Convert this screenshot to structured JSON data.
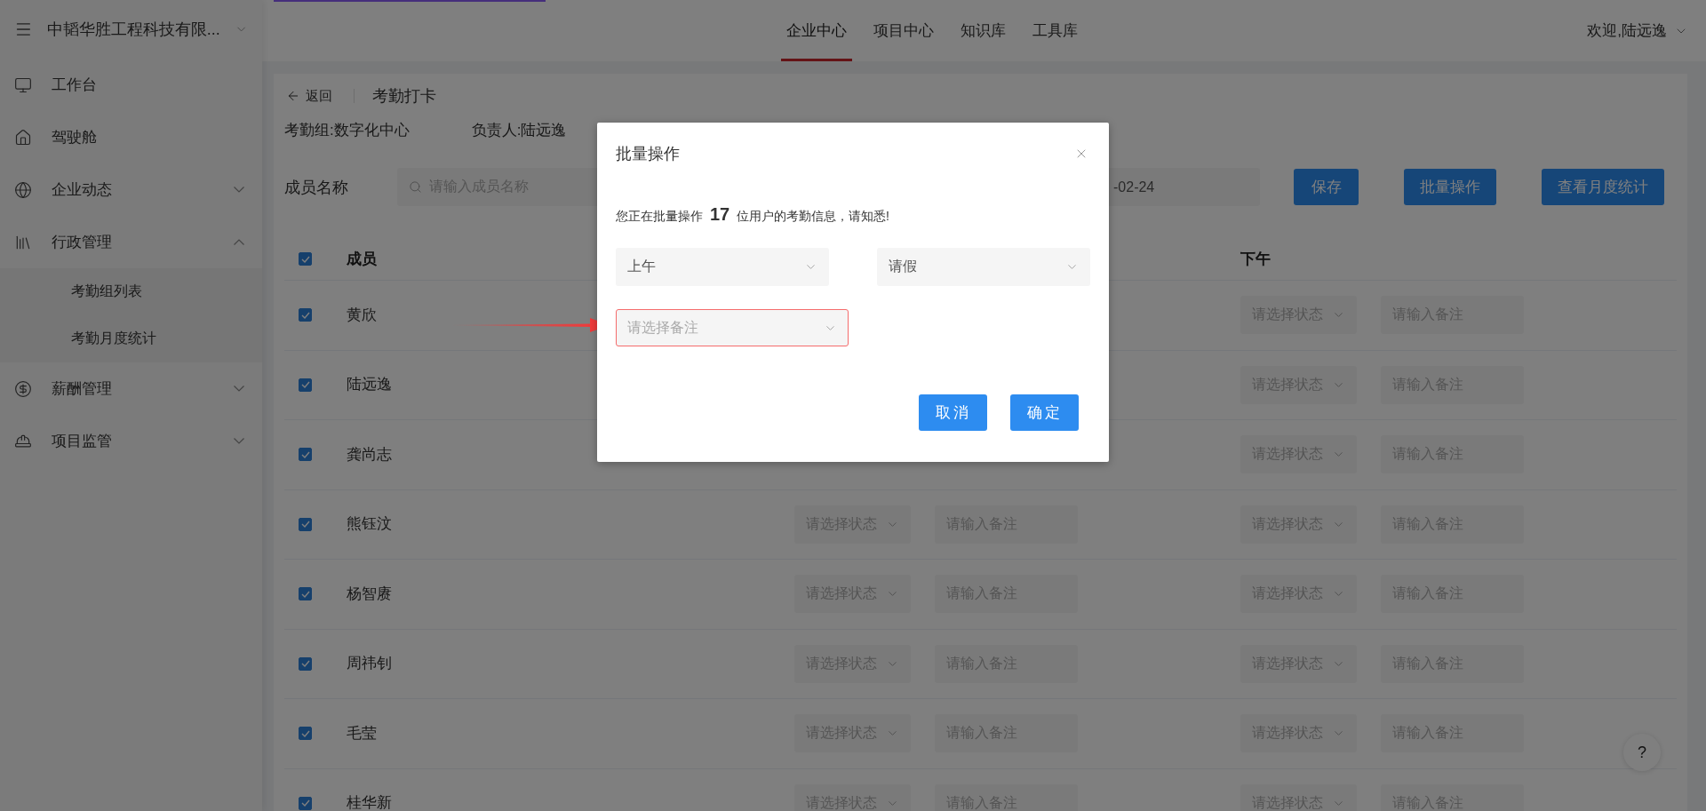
{
  "header": {
    "company": "中韬华胜工程科技有限...",
    "nav": [
      {
        "label": "企业中心",
        "selected": true
      },
      {
        "label": "项目中心",
        "selected": false
      },
      {
        "label": "知识库",
        "selected": false
      },
      {
        "label": "工具库",
        "selected": false
      }
    ],
    "user": "欢迎,陆远逸"
  },
  "sidebar": {
    "items": [
      {
        "label": "工作台"
      },
      {
        "label": "驾驶舱"
      },
      {
        "label": "企业动态",
        "expanded": false
      },
      {
        "label": "行政管理",
        "expanded": true,
        "children": [
          {
            "label": "考勤组列表"
          },
          {
            "label": "考勤月度统计"
          }
        ]
      },
      {
        "label": "薪酬管理",
        "expanded": false
      },
      {
        "label": "项目监管",
        "expanded": false
      }
    ]
  },
  "page": {
    "back": "返回",
    "title": "考勤打卡",
    "group": "考勤组:数字化中心",
    "owner": "负责人:陆远逸"
  },
  "filters": {
    "member_label": "成员名称",
    "search_placeholder": "请输入成员名称",
    "date": "-02-24"
  },
  "actions": [
    "保存",
    "批量操作",
    "查看月度统计"
  ],
  "table": {
    "all_checked": true,
    "columns": [
      "成员",
      "下午"
    ],
    "rows": [
      {
        "name": "黄欣",
        "checked": true,
        "pm_status": "请选择状态",
        "pm_note": "请输入备注"
      },
      {
        "name": "陆远逸",
        "checked": true,
        "pm_status": "请选择状态",
        "pm_note": "请输入备注"
      },
      {
        "name": "龚尚志",
        "checked": true,
        "pm_status": "请选择状态",
        "pm_note": "请输入备注"
      },
      {
        "name": "熊钰汶",
        "checked": true,
        "am_status": "请选择状态",
        "am_note": "请输入备注",
        "pm_status": "请选择状态",
        "pm_note": "请输入备注"
      },
      {
        "name": "杨智赓",
        "checked": true,
        "am_status": "请选择状态",
        "am_note": "请输入备注",
        "pm_status": "请选择状态",
        "pm_note": "请输入备注"
      },
      {
        "name": "周祎钊",
        "checked": true,
        "am_status": "请选择状态",
        "am_note": "请输入备注",
        "pm_status": "请选择状态",
        "pm_note": "请输入备注"
      },
      {
        "name": "毛莹",
        "checked": true,
        "am_status": "请选择状态",
        "am_note": "请输入备注",
        "pm_status": "请选择状态",
        "pm_note": "请输入备注"
      },
      {
        "name": "桂华新",
        "checked": true,
        "am_status": "请选择状态",
        "am_note": "请输入备注",
        "pm_status": "请选择状态",
        "pm_note": "请输入备注"
      }
    ]
  },
  "dialog": {
    "title": "批量操作",
    "message": "您正在批量操作 **17** 位用户的考勤信息，请知悉!",
    "period": "上午",
    "type": "请假",
    "remark": {
      "placeholder": "请选择备注",
      "invalid": true
    },
    "buttons": [
      "取消",
      "确定"
    ]
  },
  "help": "?"
}
